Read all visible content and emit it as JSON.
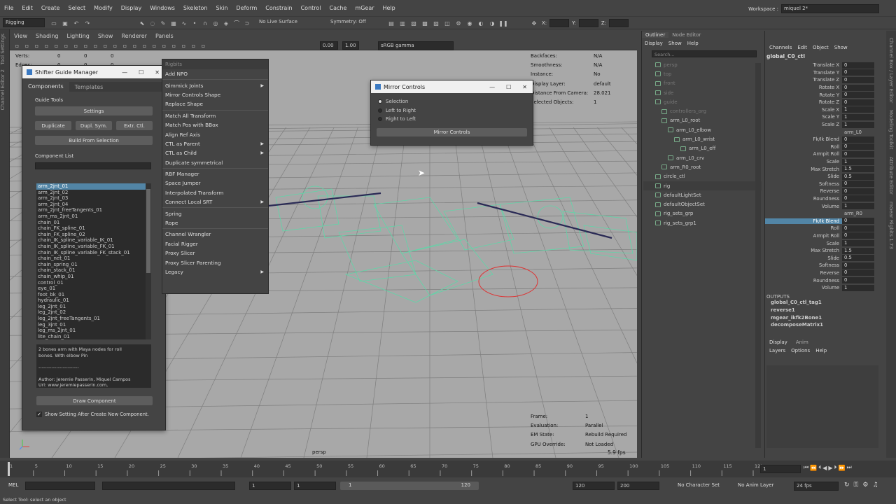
{
  "menubar": {
    "items": [
      "File",
      "Edit",
      "Create",
      "Select",
      "Modify",
      "Display",
      "Windows",
      "Skeleton",
      "Skin",
      "Deform",
      "Constrain",
      "Control",
      "Cache",
      "mGear",
      "Help"
    ],
    "workspace_label": "Workspace :",
    "workspace_value": "miquel 2*"
  },
  "statusline": {
    "mode": "Rigging",
    "live_surface": "No Live Surface",
    "symmetry": "Symmetry: Off",
    "x_label": "X:",
    "y_label": "Y:",
    "z_label": "Z:"
  },
  "viewport": {
    "menu": [
      "View",
      "Shading",
      "Lighting",
      "Show",
      "Renderer",
      "Panels"
    ],
    "exposure": "0.00",
    "gamma": "1.00",
    "colorspace": "sRGB gamma",
    "camera": "persp",
    "fps": "5.9 fps",
    "hud_left": [
      {
        "label": "Verts:",
        "v1": "0",
        "v2": "0",
        "v3": "0"
      },
      {
        "label": "Edges:",
        "v1": "0",
        "v2": "0",
        "v3": "0"
      }
    ],
    "hud_right": [
      {
        "label": "Backfaces:",
        "value": "N/A"
      },
      {
        "label": "Smoothness:",
        "value": "N/A"
      },
      {
        "label": "Instance:",
        "value": "No"
      },
      {
        "label": "Display Layer:",
        "value": "default"
      },
      {
        "label": "Distance From Camera:",
        "value": "28.021"
      },
      {
        "label": "Selected Objects:",
        "value": "1"
      }
    ],
    "hud_bottom": [
      {
        "label": "Frame:",
        "value": "1"
      },
      {
        "label": "Evaluation:",
        "value": "Parallel"
      },
      {
        "label": "EM State:",
        "value": "Rebuild Required"
      },
      {
        "label": "GPU Override:",
        "value": "Not Loaded"
      }
    ]
  },
  "shifter": {
    "title": "Shifter Guide Manager",
    "tabs": [
      "Components",
      "Templates"
    ],
    "guide_tools": "Guide Tools",
    "settings": "Settings",
    "duplicate": "Duplicate",
    "dupl_sym": "Dupl. Sym.",
    "extr_ctl": "Extr. Ctl.",
    "build": "Build From Selection",
    "component_list": "Component List",
    "components": [
      "arm_2jnt_01",
      "arm_2jnt_02",
      "arm_2jnt_03",
      "arm_2jnt_04",
      "arm_2jnt_freeTangents_01",
      "arm_ms_2jnt_01",
      "chain_01",
      "chain_FK_spline_01",
      "chain_FK_spline_02",
      "chain_IK_spline_variable_IK_01",
      "chain_IK_spline_variable_FK_01",
      "chain_IK_spline_variable_FK_stack_01",
      "chain_net_01",
      "chain_spring_01",
      "chain_stack_01",
      "chain_whip_01",
      "control_01",
      "eye_01",
      "foot_bk_01",
      "hydraulic_01",
      "leg_2jnt_01",
      "leg_2jnt_02",
      "leg_2jnt_freeTangents_01",
      "leg_3jnt_01",
      "leg_ms_2jnt_01",
      "lite_chain_01"
    ],
    "desc_lines": [
      "2 bones arm with Maya nodes for roll",
      "bones. With elbow Pin",
      "",
      "-------------------------",
      "",
      "Author: Jeremie Passerin, Miquel Campos",
      "Url: www.jeremiepasserin.com,"
    ],
    "draw": "Draw Component",
    "show_setting": "Show Setting After Create New Component."
  },
  "rbmenu": {
    "title": "Rigbits",
    "items": [
      {
        "label": "Add NPO",
        "sub": false
      },
      {
        "label": "Gimmick Joints",
        "sub": true
      },
      {
        "label": "Mirror Controls Shape",
        "sub": false
      },
      {
        "label": "Replace Shape",
        "sub": false
      },
      {
        "label": "Match All Transform",
        "sub": false
      },
      {
        "label": "Match Pos with BBox",
        "sub": false
      },
      {
        "label": "Align Ref Axis",
        "sub": false
      },
      {
        "label": "CTL as Parent",
        "sub": true
      },
      {
        "label": "CTL as Child",
        "sub": true
      },
      {
        "label": "Duplicate symmetrical",
        "sub": false
      },
      {
        "label": "RBF Manager",
        "sub": false
      },
      {
        "label": "Space Jumper",
        "sub": false
      },
      {
        "label": "Interpolated Transform",
        "sub": false
      },
      {
        "label": "Connect Local SRT",
        "sub": true
      },
      {
        "label": "Spring",
        "sub": false
      },
      {
        "label": "Rope",
        "sub": false
      },
      {
        "label": "Channel Wrangler",
        "sub": false
      },
      {
        "label": "Facial Rigger",
        "sub": false
      },
      {
        "label": "Proxy Slicer",
        "sub": false
      },
      {
        "label": "Proxy Slicer Parenting",
        "sub": false
      },
      {
        "label": "Legacy",
        "sub": true
      }
    ]
  },
  "mirror": {
    "title": "Mirror Controls",
    "options": [
      "Selection",
      "Left to Right",
      "Right to Left"
    ],
    "button": "Mirror Controls"
  },
  "outliner": {
    "tabs": [
      "Outliner",
      "Node Editor"
    ],
    "menu": [
      "Display",
      "Show",
      "Help"
    ],
    "search_placeholder": "Search...",
    "items": [
      {
        "label": "persp",
        "depth": 1,
        "dim": true
      },
      {
        "label": "top",
        "depth": 1,
        "dim": true
      },
      {
        "label": "front",
        "depth": 1,
        "dim": true
      },
      {
        "label": "side",
        "depth": 1,
        "dim": true
      },
      {
        "label": "guide",
        "depth": 1,
        "dim": true
      },
      {
        "label": "controllers_org",
        "depth": 2,
        "dim": true
      },
      {
        "label": "arm_L0_root",
        "depth": 2,
        "dim": false
      },
      {
        "label": "arm_L0_elbow",
        "depth": 3,
        "dim": false
      },
      {
        "label": "arm_L0_wrist",
        "depth": 4,
        "dim": false
      },
      {
        "label": "arm_L0_eff",
        "depth": 5,
        "dim": false
      },
      {
        "label": "arm_L0_crv",
        "depth": 3,
        "dim": false
      },
      {
        "label": "arm_R0_root",
        "depth": 2,
        "dim": false
      },
      {
        "label": "circle_ctl",
        "depth": 1,
        "dim": false
      },
      {
        "label": "rig",
        "depth": 1,
        "dim": false,
        "sel": true
      },
      {
        "label": "defaultLightSet",
        "depth": 1,
        "dim": false
      },
      {
        "label": "defaultObjectSet",
        "depth": 1,
        "dim": false
      },
      {
        "label": "rig_sets_grp",
        "depth": 1,
        "dim": false
      },
      {
        "label": "rig_sets_grp1",
        "depth": 1,
        "dim": false
      }
    ]
  },
  "channel": {
    "menu": [
      "Channels",
      "Edit",
      "Object",
      "Show"
    ],
    "node": "global_C0_ctl",
    "attrs": [
      {
        "n": "Translate X",
        "v": "0"
      },
      {
        "n": "Translate Y",
        "v": "0"
      },
      {
        "n": "Translate Z",
        "v": "0"
      },
      {
        "n": "Rotate X",
        "v": "0"
      },
      {
        "n": "Rotate Y",
        "v": "0"
      },
      {
        "n": "Rotate Z",
        "v": "0"
      },
      {
        "n": "Scale X",
        "v": "1"
      },
      {
        "n": "Scale Y",
        "v": "1"
      },
      {
        "n": "Scale Z",
        "v": "1"
      },
      {
        "n": "",
        "v": "arm_L0"
      },
      {
        "n": "Fk/Ik Blend",
        "v": "0"
      },
      {
        "n": "Roll",
        "v": "0"
      },
      {
        "n": "Armpit Roll",
        "v": "0"
      },
      {
        "n": "Scale",
        "v": "1"
      },
      {
        "n": "Max Stretch",
        "v": "1.5"
      },
      {
        "n": "Slide",
        "v": "0.5"
      },
      {
        "n": "Softness",
        "v": "0"
      },
      {
        "n": "Reverse",
        "v": "0"
      },
      {
        "n": "Roundness",
        "v": "0"
      },
      {
        "n": "Volume",
        "v": "1"
      },
      {
        "n": "",
        "v": "arm_R0"
      },
      {
        "n": "Fk/Ik Blend",
        "v": "0",
        "hl": true
      },
      {
        "n": "Roll",
        "v": "0"
      },
      {
        "n": "Armpit Roll",
        "v": "0"
      },
      {
        "n": "Scale",
        "v": "1"
      },
      {
        "n": "Max Stretch",
        "v": "1.5"
      },
      {
        "n": "Slide",
        "v": "0.5"
      },
      {
        "n": "Softness",
        "v": "0"
      },
      {
        "n": "Reverse",
        "v": "0"
      },
      {
        "n": "Roundness",
        "v": "0"
      },
      {
        "n": "Volume",
        "v": "1"
      }
    ],
    "outputs_label": "OUTPUTS",
    "outputs": [
      "global_C0_ctl_tag1",
      "reverse1",
      "mgear_ikfk2Bone1",
      "decomposeMatrix1"
    ],
    "tabs": [
      "Display",
      "Anim"
    ],
    "lmenu": [
      "Layers",
      "Options",
      "Help"
    ],
    "side_tabs": [
      "Channel Box / Layer Editor",
      "Modeling Toolkit",
      "Attribute Editor",
      "mGear Rigbits 1.73"
    ]
  },
  "left_tabs": [
    "Tool Settings",
    "Channel Editor 2"
  ],
  "timeslider": {
    "ticks": [
      "1",
      "5",
      "10",
      "15",
      "20",
      "25",
      "30",
      "35",
      "40",
      "45",
      "50",
      "55",
      "60",
      "65",
      "70",
      "75",
      "80",
      "85",
      "90",
      "95",
      "100",
      "105",
      "110",
      "115",
      "120"
    ],
    "current": "1"
  },
  "range": {
    "mel": "MEL",
    "start": "1",
    "start2": "1",
    "slider_start": "1",
    "slider_end": "120",
    "end": "120",
    "end2": "200",
    "char_set": "No Character Set",
    "anim_layer": "No Anim Layer",
    "fps": "24 fps"
  },
  "helpline": "Select Tool: select an object"
}
